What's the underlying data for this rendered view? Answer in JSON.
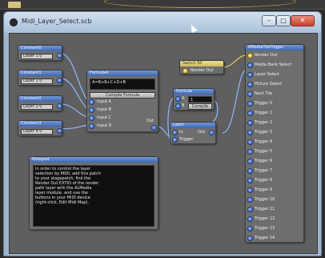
{
  "window": {
    "title": "Midi_Layer_Select.scb",
    "minimize_label": "–",
    "maximize_label": "□",
    "close_label": "✕"
  },
  "nodes": {
    "constants": [
      {
        "title": "Constant0",
        "value": "Layer 1  0"
      },
      {
        "title": "Constant1",
        "value": "Layer 1  0"
      },
      {
        "title": "Constant2",
        "value": "Layer 2  0"
      },
      {
        "title": "Constant3",
        "value": "Layer 4  0"
      }
    ],
    "formula": {
      "title": "Formula4",
      "expression": "A=B+B+C+D+B",
      "compile_label": "Compile Formula",
      "inputs": [
        "Input A",
        "Input B",
        "Input C",
        "Input D"
      ],
      "output_label": "Out"
    },
    "switch": {
      "title": "Switch 50",
      "output_label": "Render Out"
    },
    "formula2": {
      "title": "Formula",
      "row_a": "A",
      "row_b": "B",
      "value": "1",
      "compile_label": "Compile"
    },
    "latch": {
      "title": "Latch",
      "input_label": "In",
      "trigger_label": "Trigger",
      "output_label": "Out"
    },
    "notepad": {
      "title": "Notepad",
      "lines": [
        "In order to control the layer",
        "selection by MIDI, add this patch",
        "to your stagepatch, link the",
        "Render Out EXTIO of the render",
        "path layer with the ALMedia",
        "layer module, and use the",
        "buttons in your MIDI device",
        "(right-click, Edit Midi Map)."
      ]
    },
    "trigger": {
      "title": "AMediaTileTrigger",
      "ports": [
        "Render Out",
        "Media Bank Select",
        "Layer Select",
        "Picture Select",
        "Next Tile",
        "Trigger 0",
        "Trigger 1",
        "Trigger 2",
        "Trigger 3",
        "Trigger 4",
        "Trigger 5",
        "Trigger 6",
        "Trigger 7",
        "Trigger 8",
        "Trigger 9",
        "Trigger 10",
        "Trigger 11",
        "Trigger 12",
        "Trigger 13",
        "Trigger 14"
      ]
    }
  }
}
